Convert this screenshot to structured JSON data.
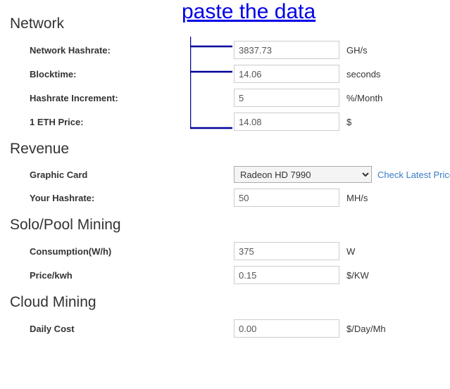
{
  "annotation": {
    "text": "paste the data"
  },
  "network": {
    "heading": "Network",
    "hashrate": {
      "label": "Network Hashrate:",
      "value": "3837.73",
      "unit": "GH/s"
    },
    "blocktime": {
      "label": "Blocktime:",
      "value": "14.06",
      "unit": "seconds"
    },
    "increment": {
      "label": "Hashrate Increment:",
      "value": "5",
      "unit": "%/Month"
    },
    "ethprice": {
      "label": "1 ETH Price:",
      "value": "14.08",
      "unit": "$"
    }
  },
  "revenue": {
    "heading": "Revenue",
    "card": {
      "label": "Graphic Card",
      "selected": "Radeon HD 7990",
      "link": "Check Latest Price"
    },
    "hashrate": {
      "label": "Your Hashrate:",
      "value": "50",
      "unit": "MH/s"
    }
  },
  "mining": {
    "heading": "Solo/Pool Mining",
    "consumption": {
      "label": "Consumption(W/h)",
      "value": "375",
      "unit": "W"
    },
    "pricekwh": {
      "label": "Price/kwh",
      "value": "0.15",
      "unit": "$/KW"
    }
  },
  "cloud": {
    "heading": "Cloud Mining",
    "dailycost": {
      "label": "Daily Cost",
      "value": "0.00",
      "unit": "$/Day/Mh"
    }
  }
}
